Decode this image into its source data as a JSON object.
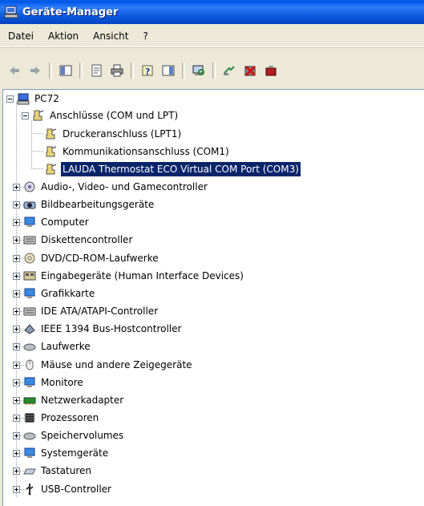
{
  "window": {
    "title": "Geräte-Manager"
  },
  "menu": [
    "Datei",
    "Aktion",
    "Ansicht",
    "?"
  ],
  "toolbar": [
    "back-icon",
    "forward-icon",
    "show-hide-tree-icon",
    "properties-icon",
    "print-icon",
    "help-icon",
    "console-tree-icon",
    "scan-hardware-icon",
    "update-driver-icon",
    "disable-device-icon",
    "uninstall-device-icon"
  ],
  "tree": {
    "root": "PC72",
    "ports": {
      "label": "Anschlüsse (COM und LPT)",
      "children": [
        "Druckeranschluss (LPT1)",
        "Kommunikationsanschluss (COM1)",
        "LAUDA Thermostat ECO Virtual COM Port (COM3)"
      ],
      "selected_index": 2
    },
    "categories": [
      {
        "label": "Audio-, Video- und Gamecontroller",
        "icon": "audio-icon"
      },
      {
        "label": "Bildbearbeitungsgeräte",
        "icon": "camera-icon"
      },
      {
        "label": "Computer",
        "icon": "computer-icon"
      },
      {
        "label": "Diskettencontroller",
        "icon": "floppy-controller-icon"
      },
      {
        "label": "DVD/CD-ROM-Laufwerke",
        "icon": "cdrom-icon"
      },
      {
        "label": "Eingabegeräte (Human Interface Devices)",
        "icon": "hid-icon"
      },
      {
        "label": "Grafikkarte",
        "icon": "display-adapter-icon"
      },
      {
        "label": "IDE ATA/ATAPI-Controller",
        "icon": "ide-controller-icon"
      },
      {
        "label": "IEEE 1394 Bus-Hostcontroller",
        "icon": "firewire-icon"
      },
      {
        "label": "Laufwerke",
        "icon": "disk-drive-icon"
      },
      {
        "label": "Mäuse und andere Zeigegeräte",
        "icon": "mouse-icon"
      },
      {
        "label": "Monitore",
        "icon": "monitor-icon"
      },
      {
        "label": "Netzwerkadapter",
        "icon": "network-adapter-icon"
      },
      {
        "label": "Prozessoren",
        "icon": "processor-icon"
      },
      {
        "label": "Speichervolumes",
        "icon": "storage-volume-icon"
      },
      {
        "label": "Systemgeräte",
        "icon": "system-device-icon"
      },
      {
        "label": "Tastaturen",
        "icon": "keyboard-icon"
      },
      {
        "label": "USB-Controller",
        "icon": "usb-icon"
      }
    ]
  },
  "colors": {
    "title_bar": "#0a57d8",
    "selection": "#0a246a",
    "window_bg": "#ece9d8"
  }
}
